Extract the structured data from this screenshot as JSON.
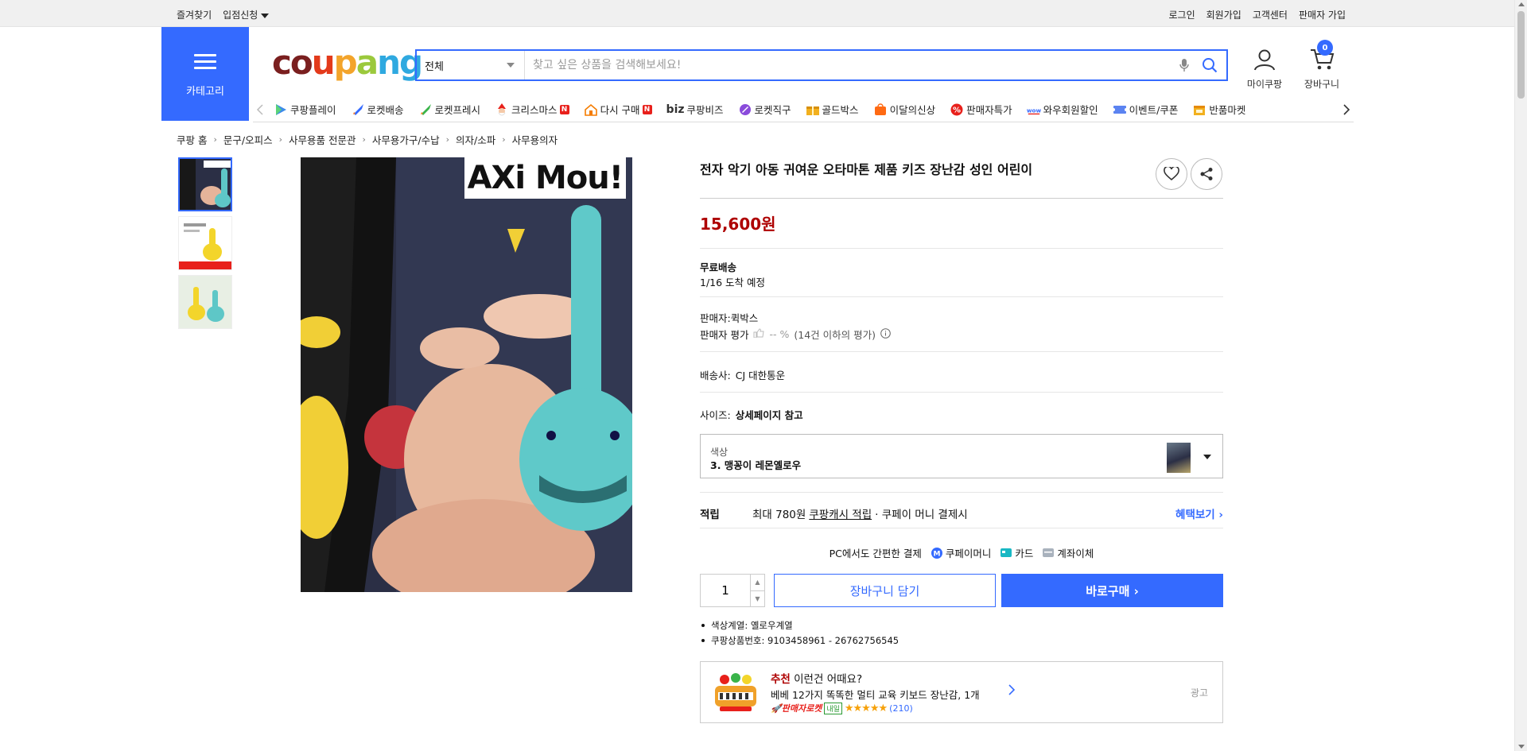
{
  "topbar": {
    "left": [
      "즐겨찾기",
      "입점신청"
    ],
    "right": [
      "로그인",
      "회원가입",
      "고객센터",
      "판매자 가입"
    ]
  },
  "header": {
    "category_label": "카테고리",
    "search_category": "전체",
    "search_placeholder": "찾고 싶은 상품을 검색해보세요!",
    "mypage_label": "마이쿠팡",
    "cart_label": "장바구니",
    "cart_count": "0",
    "brand_color": "#346aff"
  },
  "nav": [
    {
      "label": "쿠팡플레이",
      "icon": "play-icon"
    },
    {
      "label": "로켓배송",
      "icon": "rocket-icon"
    },
    {
      "label": "로켓프레시",
      "icon": "rocket-fresh-icon"
    },
    {
      "label": "크리스마스",
      "icon": "santa-icon",
      "badge": "N"
    },
    {
      "label": "다시 구매",
      "icon": "home-icon",
      "badge": "N"
    },
    {
      "label": "쿠팡비즈",
      "prefix": "biz",
      "icon": "biz-icon"
    },
    {
      "label": "로켓직구",
      "icon": "globe-rocket-icon"
    },
    {
      "label": "골드박스",
      "icon": "gold-box-icon"
    },
    {
      "label": "이달의신상",
      "icon": "new-bag-icon"
    },
    {
      "label": "판매자특가",
      "icon": "percent-icon"
    },
    {
      "label": "와우회원할인",
      "icon": "wow-icon"
    },
    {
      "label": "이벤트/쿠폰",
      "icon": "coupon-icon"
    },
    {
      "label": "반품마켓",
      "icon": "return-market-icon"
    }
  ],
  "breadcrumb": [
    "쿠팡 홈",
    "문구/오피스",
    "사무용품 전문관",
    "사무용가구/수납",
    "의자/소파",
    "사무용의자"
  ],
  "image": {
    "watermark": "AXi Mou!"
  },
  "product": {
    "title": "전자 악기 아동 귀여운 오타마톤 제품 키즈 장난감 성인 어린이",
    "price": "15,600원",
    "shipping_title": "무료배송",
    "arrival": "1/16 도착 예정",
    "seller_prefix": "판매자:",
    "seller": "퀵박스",
    "seller_rating_label": "판매자 평가",
    "seller_rating_value": "-- %",
    "seller_rating_note": "(14건 이하의 평가)",
    "carrier_label": "배송사:",
    "carrier": "CJ 대한통운",
    "size_label": "사이즈:",
    "size_value": "상세페이지 참고",
    "option_key": "색상",
    "option_value": "3. 맹꽁이 레몬옐로우",
    "reward_label": "적립",
    "reward_pre": "최대 780원",
    "reward_link": "쿠팡캐시 적립",
    "reward_post": "· 쿠페이 머니 결제시",
    "reward_more": "혜택보기",
    "pc_pay_label": "PC에서도 간편한 결제",
    "pay_methods": [
      "쿠페이머니",
      "카드",
      "계좌이체"
    ],
    "quantity": "1",
    "cart_button": "장바구니 담기",
    "buy_button": "바로구매",
    "specs": [
      "색상계열: 옐로우계열",
      "쿠팡상품번호: 9103458961 - 26762756545"
    ],
    "price_color": "#ae0000"
  },
  "ad": {
    "highlight": "추천",
    "headline": "이런건 어때요?",
    "product": "베베 12가지 똑똑한 멀티 교육 키보드 장난감, 1개",
    "badge": "판매자로켓",
    "tomorrow": "내일",
    "stars": "★★★★★",
    "review_count": "(210)",
    "tag": "광고"
  }
}
